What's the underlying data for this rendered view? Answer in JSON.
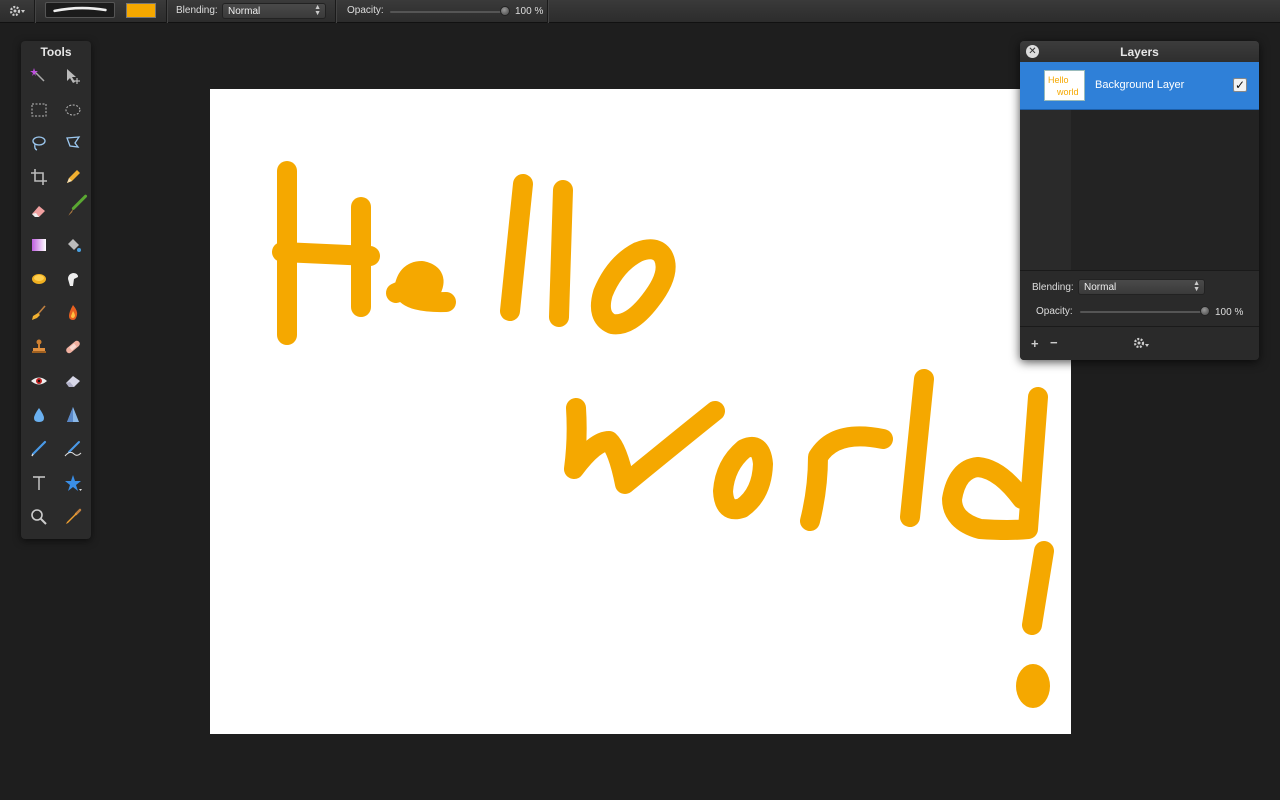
{
  "topbar": {
    "blending_label": "Blending:",
    "blending_value": "Normal",
    "opacity_label": "Opacity:",
    "opacity_value": "100 %",
    "opacity_fraction": 1.0,
    "brush_color": "#f5a800"
  },
  "tools_panel": {
    "title": "Tools",
    "tools": [
      "magic-wand",
      "move-selection",
      "rect-marquee",
      "ellipse-marquee",
      "lasso",
      "polygon-lasso",
      "crop",
      "pencil",
      "eraser",
      "paintbrush",
      "gradient",
      "clone-fill",
      "paint-bucket",
      "smudge",
      "broom",
      "burn",
      "stamp",
      "healing",
      "red-eye",
      "eraser-2",
      "blur",
      "sharpen",
      "pen",
      "freeform-pen",
      "text",
      "shape",
      "zoom",
      "color-picker"
    ]
  },
  "canvas": {
    "background": "#ffffff",
    "stroke_color": "#f5a800",
    "drawn_text": "Hello world!"
  },
  "layers_panel": {
    "title": "Layers",
    "layers": [
      {
        "name": "Background Layer",
        "visible": true,
        "selected": true
      }
    ],
    "blending_label": "Blending:",
    "blending_value": "Normal",
    "opacity_label": "Opacity:",
    "opacity_value": "100 %",
    "opacity_fraction": 1.0,
    "thumb_text_line1": "Hello",
    "thumb_text_line2": "world",
    "add_label": "+",
    "remove_label": "−"
  },
  "colors": {
    "accent": "#2f80d8",
    "orange": "#f5a800"
  }
}
